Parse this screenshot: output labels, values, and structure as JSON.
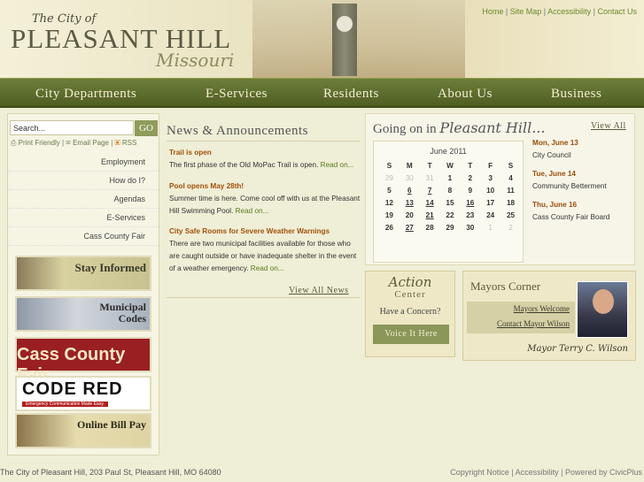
{
  "header": {
    "logo_the": "The City of",
    "logo_main": "PLEASANT HILL",
    "logo_state": "Missouri",
    "util_nav": [
      "Home",
      "Site Map",
      "Accessibility",
      "Contact Us"
    ]
  },
  "nav": [
    "City Departments",
    "E-Services",
    "Residents",
    "About Us",
    "Business"
  ],
  "sidebar": {
    "search_value": "Search...",
    "go_label": "GO",
    "tools": {
      "print": "Print Friendly",
      "email": "Email Page",
      "rss": "RSS"
    },
    "links": [
      "Employment",
      "How do I?",
      "Agendas",
      "E-Services",
      "Cass County Fair"
    ],
    "banners": [
      "Stay Informed",
      "Municipal Codes",
      "Cass County Fair",
      "CODE RED",
      "Emergency Communication Made Easy.",
      "Online Bill Pay"
    ]
  },
  "news": {
    "title": "News & Announcements",
    "items": [
      {
        "title": "Trail is open",
        "body": "The first phase of the Old MoPac Trail is open.",
        "link": "Read on..."
      },
      {
        "title": "Pool opens May 28th!",
        "body": "Summer time is here. Come cool off with us at the Pleasant Hill Swimming Pool.",
        "link": "Read on..."
      },
      {
        "title": "City Safe Rooms for Severe Weather Warnings",
        "body": "There are two municipal facilities available for those who are caught outside or have inadequate shelter in the event of a weather emergency.",
        "link": "Read on..."
      }
    ],
    "view_all": "View All News"
  },
  "events": {
    "title_prefix": "Going on in",
    "title_script": "Pleasant Hill...",
    "view_all": "View All",
    "calendar": {
      "month": "June 2011",
      "days": [
        "S",
        "M",
        "T",
        "W",
        "T",
        "F",
        "S"
      ],
      "weeks": [
        [
          "29",
          "30",
          "31",
          "1",
          "2",
          "3",
          "4"
        ],
        [
          "5",
          "6",
          "7",
          "8",
          "9",
          "10",
          "11"
        ],
        [
          "12",
          "13",
          "14",
          "15",
          "16",
          "17",
          "18"
        ],
        [
          "19",
          "20",
          "21",
          "22",
          "23",
          "24",
          "25"
        ],
        [
          "26",
          "27",
          "28",
          "29",
          "30",
          "1",
          "2"
        ]
      ]
    },
    "list": [
      {
        "date": "Mon, June 13",
        "name": "City Council"
      },
      {
        "date": "Tue, June 14",
        "name": "Community Betterment"
      },
      {
        "date": "Thu, June 16",
        "name": "Cass County Fair Board"
      }
    ]
  },
  "action_center": {
    "title": "Action",
    "subtitle": "Center",
    "prompt": "Have a Concern?",
    "button": "Voice It Here"
  },
  "mayors_corner": {
    "title": "Mayors Corner",
    "welcome": "Mayors Welcome",
    "contact": "Contact Mayor Wilson",
    "signature": "Mayor Terry C. Wilson"
  },
  "footer": {
    "address": "The City of Pleasant Hill, 203 Paul St, Pleasant Hill, MO 64080",
    "links": [
      "Copyright Notice",
      "Accessibility",
      "Powered by CivicPlus"
    ]
  },
  "colors": {
    "nav_green": "#5a6a2a",
    "accent_orange": "#a3520a",
    "link_green": "#5a7a1c"
  }
}
